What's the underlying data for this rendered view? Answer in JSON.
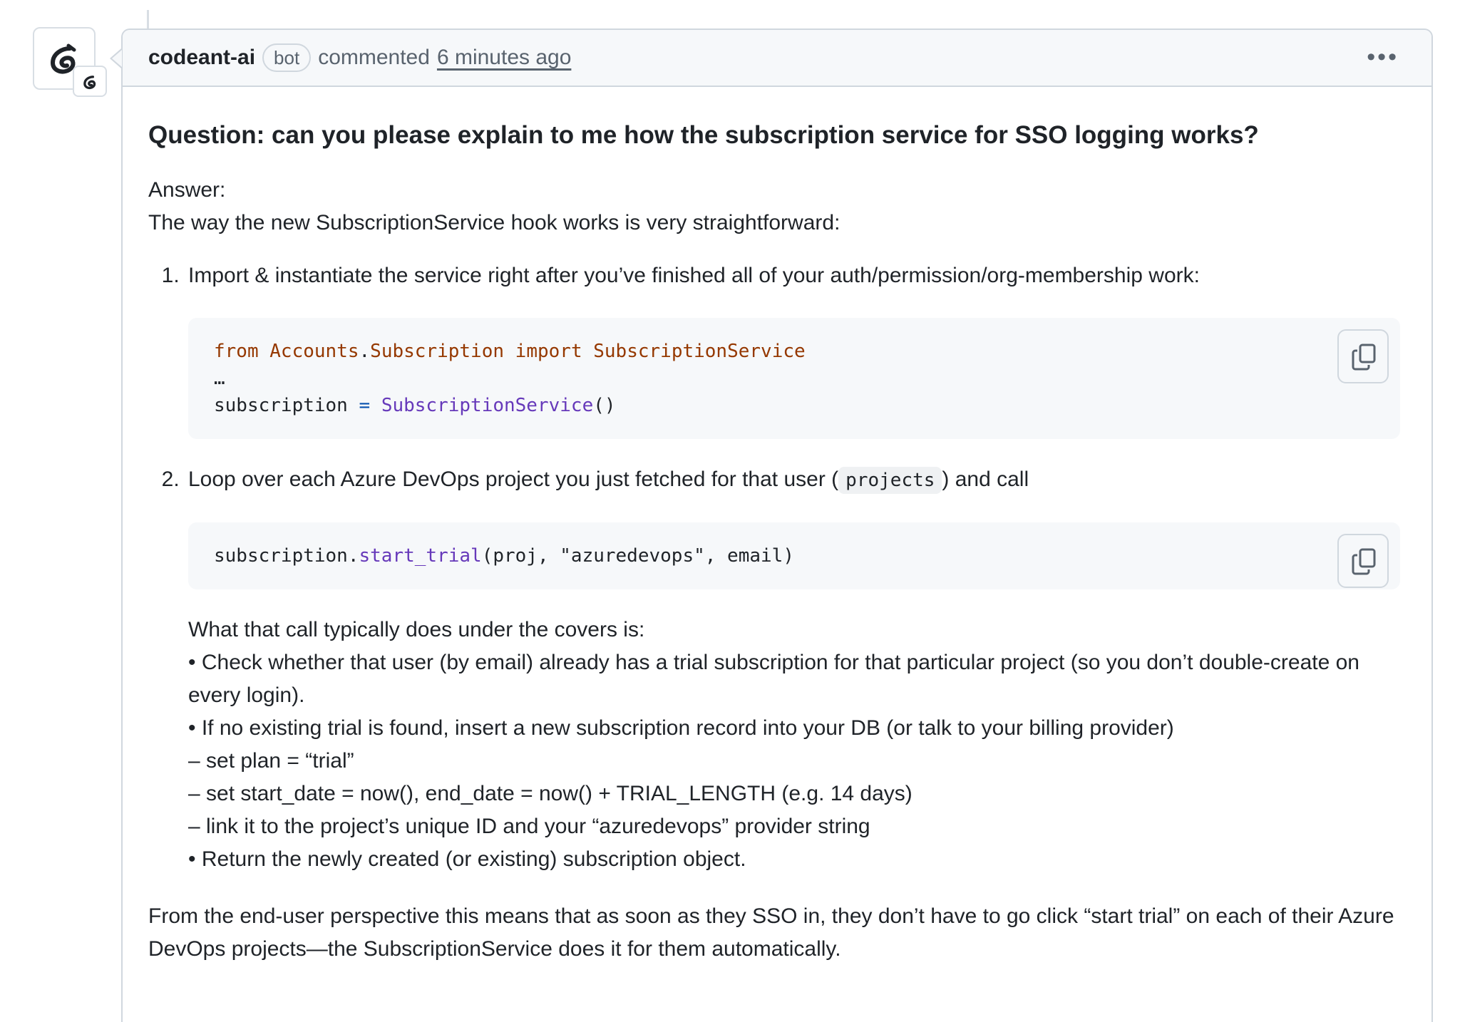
{
  "comment": {
    "author": "codeant-ai",
    "badge": "bot",
    "action": "commented",
    "time": "6 minutes ago",
    "more_label": "•••"
  },
  "content": {
    "question": "Question: can you please explain to me how the subscription service for SSO logging works?",
    "answer_label": "Answer:",
    "intro": "The way the new SubscriptionService hook works is very straightforward:",
    "step1": "Import & instantiate the service right after you’ve finished all of your auth/permission/org-membership work:",
    "code1": {
      "l1_from": "from",
      "l1_mod1": "Accounts",
      "l1_dot": ".",
      "l1_mod2": "Subscription",
      "l1_import": "import",
      "l1_cls": "SubscriptionService",
      "l2": "…",
      "l3_var": "subscription",
      "l3_eq": "=",
      "l3_cls": "SubscriptionService",
      "l3_paren": "()"
    },
    "step2_before": "Loop over each Azure DevOps project you just fetched for that user (",
    "step2_code": "projects",
    "step2_after": ") and call",
    "code2": {
      "obj": "subscription",
      "dot": ".",
      "method": "start_trial",
      "args": "(proj, \"azuredevops\", email)"
    },
    "details": [
      "What that call typically does under the covers is:",
      "• Check whether that user (by email) already has a trial subscription for that particular project (so you don’t double-create on every login).",
      "• If no existing trial is found, insert a new subscription record into your DB (or talk to your billing provider)",
      "– set plan = “trial”",
      "– set start_date = now(), end_date = now() + TRIAL_LENGTH (e.g. 14 days)",
      "– link it to the project’s unique ID and your “azuredevops” provider string",
      "• Return the newly created (or existing) subscription object."
    ],
    "closing": "From the end-user perspective this means that as soon as they SSO in, they don’t have to go click “start trial” on each of their Azure DevOps projects—the SubscriptionService does it for them automatically."
  }
}
